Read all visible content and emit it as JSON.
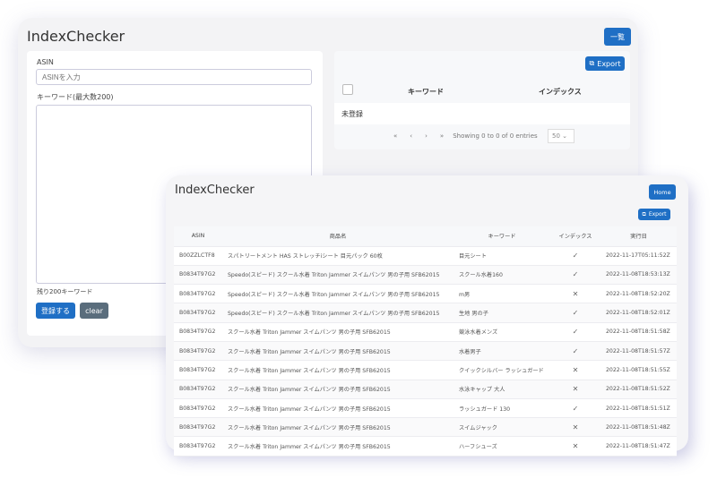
{
  "back": {
    "title": "IndexChecker",
    "list_button": "一覧",
    "asin_label": "ASIN",
    "asin_placeholder": "ASINを入力",
    "keyword_label": "キーワード(最大数200)",
    "remaining": "残り200キーワード",
    "register_button": "登録する",
    "clear_button": "clear",
    "export_button": "Export",
    "columns": [
      "キーワード",
      "インデックス"
    ],
    "empty_text": "未登録",
    "pager": {
      "first": "«",
      "prev": "‹",
      "next": "›",
      "last": "»",
      "info": "Showing 0 to 0 of 0 entries",
      "page_size": "50"
    }
  },
  "front": {
    "title": "IndexChecker",
    "home_button": "Home",
    "export_button": "Export",
    "columns": [
      "ASIN",
      "商品名",
      "キーワード",
      "インデックス",
      "実行日"
    ],
    "rows": [
      {
        "asin": "B00ZZLCTF8",
        "name": "スパトリートメント HAS ストレッチiシート 目元パック 60枚",
        "keyword": "目元シート",
        "index": "✓",
        "date": "2022-11-17T05:11:52Z"
      },
      {
        "asin": "B0834T97G2",
        "name": "Speedo(スピード) スクール水着 Triton Jammer スイムパンツ 男の子用 SFB62015",
        "keyword": "スクール水着160",
        "index": "✓",
        "date": "2022-11-08T18:53:13Z"
      },
      {
        "asin": "B0834T97G2",
        "name": "Speedo(スピード) スクール水着 Triton Jammer スイムパンツ 男の子用 SFB62015",
        "keyword": "m男",
        "index": "✕",
        "date": "2022-11-08T18:52:20Z"
      },
      {
        "asin": "B0834T97G2",
        "name": "Speedo(スピード) スクール水着 Triton Jammer スイムパンツ 男の子用 SFB62015",
        "keyword": "生地 男の子",
        "index": "✓",
        "date": "2022-11-08T18:52:01Z"
      },
      {
        "asin": "B0834T97G2",
        "name": "スクール水着 Triton Jammer スイムパンツ 男の子用 SFB62015",
        "keyword": "競泳水着メンズ",
        "index": "✓",
        "date": "2022-11-08T18:51:58Z"
      },
      {
        "asin": "B0834T97G2",
        "name": "スクール水着 Triton Jammer スイムパンツ 男の子用 SFB62015",
        "keyword": "水着男子",
        "index": "✓",
        "date": "2022-11-08T18:51:57Z"
      },
      {
        "asin": "B0834T97G2",
        "name": "スクール水着 Triton Jammer スイムパンツ 男の子用 SFB62015",
        "keyword": "クイックシルバー ラッシュガード",
        "index": "✕",
        "date": "2022-11-08T18:51:55Z"
      },
      {
        "asin": "B0834T97G2",
        "name": "スクール水着 Triton Jammer スイムパンツ 男の子用 SFB62015",
        "keyword": "水泳キャップ 大人",
        "index": "✕",
        "date": "2022-11-08T18:51:52Z"
      },
      {
        "asin": "B0834T97G2",
        "name": "スクール水着 Triton Jammer スイムパンツ 男の子用 SFB62015",
        "keyword": "ラッシュガード 130",
        "index": "✓",
        "date": "2022-11-08T18:51:51Z"
      },
      {
        "asin": "B0834T97G2",
        "name": "スクール水着 Triton Jammer スイムパンツ 男の子用 SFB62015",
        "keyword": "スイムジャック",
        "index": "✕",
        "date": "2022-11-08T18:51:48Z"
      },
      {
        "asin": "B0834T97G2",
        "name": "スクール水着 Triton Jammer スイムパンツ 男の子用 SFB62015",
        "keyword": "ハーフシューズ",
        "index": "✕",
        "date": "2022-11-08T18:51:47Z"
      }
    ]
  }
}
